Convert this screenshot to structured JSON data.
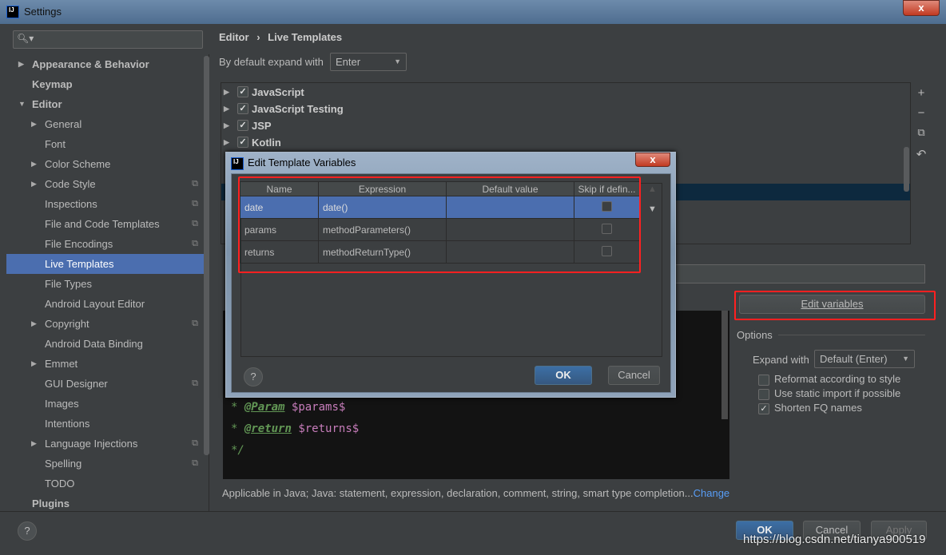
{
  "window": {
    "title": "Settings",
    "close": "x"
  },
  "sidebar": {
    "items": [
      {
        "label": "Appearance & Behavior",
        "level": 0,
        "bold": true,
        "arrow": "▶"
      },
      {
        "label": "Keymap",
        "level": 0,
        "bold": true
      },
      {
        "label": "Editor",
        "level": 0,
        "bold": true,
        "arrow": "▼"
      },
      {
        "label": "General",
        "level": 1,
        "arrow": "▶"
      },
      {
        "label": "Font",
        "level": 1
      },
      {
        "label": "Color Scheme",
        "level": 1,
        "arrow": "▶"
      },
      {
        "label": "Code Style",
        "level": 1,
        "arrow": "▶",
        "copy": true
      },
      {
        "label": "Inspections",
        "level": 1,
        "copy": true
      },
      {
        "label": "File and Code Templates",
        "level": 1,
        "copy": true
      },
      {
        "label": "File Encodings",
        "level": 1,
        "copy": true
      },
      {
        "label": "Live Templates",
        "level": 1,
        "selected": true
      },
      {
        "label": "File Types",
        "level": 1
      },
      {
        "label": "Android Layout Editor",
        "level": 1
      },
      {
        "label": "Copyright",
        "level": 1,
        "arrow": "▶",
        "copy": true
      },
      {
        "label": "Android Data Binding",
        "level": 1
      },
      {
        "label": "Emmet",
        "level": 1,
        "arrow": "▶"
      },
      {
        "label": "GUI Designer",
        "level": 1,
        "copy": true
      },
      {
        "label": "Images",
        "level": 1
      },
      {
        "label": "Intentions",
        "level": 1
      },
      {
        "label": "Language Injections",
        "level": 1,
        "arrow": "▶",
        "copy": true
      },
      {
        "label": "Spelling",
        "level": 1,
        "copy": true
      },
      {
        "label": "TODO",
        "level": 1
      },
      {
        "label": "Plugins",
        "level": 0,
        "bold": true
      }
    ]
  },
  "breadcrumb": {
    "parent": "Editor",
    "sep": "›",
    "current": "Live Templates"
  },
  "expand_default": {
    "label": "By default expand with",
    "value": "Enter"
  },
  "template_groups": [
    {
      "label": "JavaScript",
      "checked": true
    },
    {
      "label": "JavaScript Testing",
      "checked": true
    },
    {
      "label": "JSP",
      "checked": true
    },
    {
      "label": "Kotlin",
      "checked": true
    }
  ],
  "toolbar": {
    "add": "+",
    "remove": "−",
    "copy": "⧉",
    "restore": "↶"
  },
  "edit_variables_label": "Edit variables",
  "options": {
    "title": "Options",
    "expand_label": "Expand with",
    "expand_value": "Default (Enter)",
    "checks": [
      {
        "label": "Reformat according to style",
        "checked": false
      },
      {
        "label": "Use static import if possible",
        "checked": false
      },
      {
        "label": "Shorten FQ names",
        "checked": true
      }
    ]
  },
  "editor": {
    "lines": [
      {
        "star": "*",
        "tag": "@Param",
        "var": "$params$"
      },
      {
        "star": "*",
        "tag": "@return",
        "var": "$returns$"
      }
    ],
    "end": "*/"
  },
  "applicable": {
    "text": "Applicable in Java; Java: statement, expression, declaration, comment, string, smart type completion...",
    "link": "Change"
  },
  "footer": {
    "help": "?",
    "ok": "OK",
    "cancel": "Cancel",
    "apply": "Apply"
  },
  "dialog": {
    "title": "Edit Template Variables",
    "close": "x",
    "columns": [
      "Name",
      "Expression",
      "Default value",
      "Skip if defin..."
    ],
    "rows": [
      {
        "name": "date",
        "expression": "date()",
        "default": "",
        "skip": false,
        "selected": true
      },
      {
        "name": "params",
        "expression": "methodParameters()",
        "default": "",
        "skip": false
      },
      {
        "name": "returns",
        "expression": "methodReturnType()",
        "default": "",
        "skip": false
      }
    ],
    "help": "?",
    "ok": "OK",
    "cancel": "Cancel",
    "up": "▲",
    "down": "▼"
  },
  "watermark": "https://blog.csdn.net/tianya900519",
  "colors": {
    "background": "#3c3f41",
    "selection": "#4b6eaf",
    "highlight": "#ff2020",
    "link": "#589df6"
  }
}
